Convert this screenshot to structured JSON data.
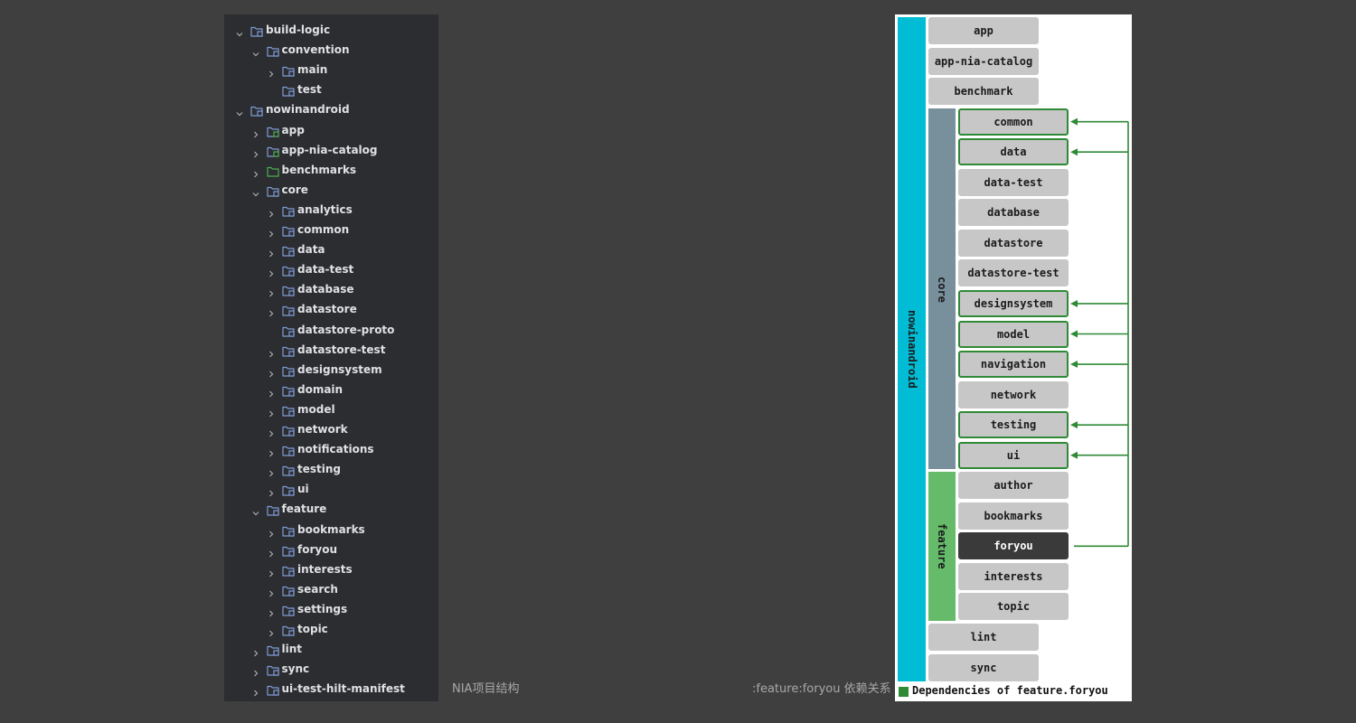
{
  "tree": [
    {
      "label": "build-logic",
      "depth": 0,
      "expanded": true,
      "icon": "module-folder-icon"
    },
    {
      "label": "convention",
      "depth": 1,
      "expanded": true,
      "icon": "module-folder-icon"
    },
    {
      "label": "main",
      "depth": 2,
      "expanded": false,
      "icon": "module-folder-icon"
    },
    {
      "label": "test",
      "depth": 2,
      "leaf": true,
      "icon": "module-folder-icon"
    },
    {
      "label": "nowinandroid",
      "depth": 0,
      "expanded": true,
      "icon": "module-folder-icon"
    },
    {
      "label": "app",
      "depth": 1,
      "expanded": false,
      "icon": "android-module-folder-icon"
    },
    {
      "label": "app-nia-catalog",
      "depth": 1,
      "expanded": false,
      "icon": "android-module-folder-icon"
    },
    {
      "label": "benchmarks",
      "depth": 1,
      "expanded": false,
      "icon": "test-folder-icon"
    },
    {
      "label": "core",
      "depth": 1,
      "expanded": true,
      "icon": "module-folder-icon"
    },
    {
      "label": "analytics",
      "depth": 2,
      "expanded": false,
      "icon": "module-folder-icon"
    },
    {
      "label": "common",
      "depth": 2,
      "expanded": false,
      "icon": "module-folder-icon"
    },
    {
      "label": "data",
      "depth": 2,
      "expanded": false,
      "icon": "module-folder-icon"
    },
    {
      "label": "data-test",
      "depth": 2,
      "expanded": false,
      "icon": "module-folder-icon"
    },
    {
      "label": "database",
      "depth": 2,
      "expanded": false,
      "icon": "module-folder-icon"
    },
    {
      "label": "datastore",
      "depth": 2,
      "expanded": false,
      "icon": "module-folder-icon"
    },
    {
      "label": "datastore-proto",
      "depth": 2,
      "leaf": true,
      "icon": "module-folder-icon"
    },
    {
      "label": "datastore-test",
      "depth": 2,
      "expanded": false,
      "icon": "module-folder-icon"
    },
    {
      "label": "designsystem",
      "depth": 2,
      "expanded": false,
      "icon": "module-folder-icon"
    },
    {
      "label": "domain",
      "depth": 2,
      "expanded": false,
      "icon": "module-folder-icon"
    },
    {
      "label": "model",
      "depth": 2,
      "expanded": false,
      "icon": "module-folder-icon"
    },
    {
      "label": "network",
      "depth": 2,
      "expanded": false,
      "icon": "module-folder-icon"
    },
    {
      "label": "notifications",
      "depth": 2,
      "expanded": false,
      "icon": "module-folder-icon"
    },
    {
      "label": "testing",
      "depth": 2,
      "expanded": false,
      "icon": "module-folder-icon"
    },
    {
      "label": "ui",
      "depth": 2,
      "expanded": false,
      "icon": "module-folder-icon"
    },
    {
      "label": "feature",
      "depth": 1,
      "expanded": true,
      "icon": "module-folder-icon"
    },
    {
      "label": "bookmarks",
      "depth": 2,
      "expanded": false,
      "icon": "module-folder-icon"
    },
    {
      "label": "foryou",
      "depth": 2,
      "expanded": false,
      "icon": "module-folder-icon"
    },
    {
      "label": "interests",
      "depth": 2,
      "expanded": false,
      "icon": "module-folder-icon"
    },
    {
      "label": "search",
      "depth": 2,
      "expanded": false,
      "icon": "module-folder-icon"
    },
    {
      "label": "settings",
      "depth": 2,
      "expanded": false,
      "icon": "module-folder-icon"
    },
    {
      "label": "topic",
      "depth": 2,
      "expanded": false,
      "icon": "module-folder-icon"
    },
    {
      "label": "lint",
      "depth": 1,
      "expanded": false,
      "icon": "module-folder-icon"
    },
    {
      "label": "sync",
      "depth": 1,
      "expanded": false,
      "icon": "module-folder-icon"
    },
    {
      "label": "ui-test-hilt-manifest",
      "depth": 1,
      "expanded": false,
      "icon": "module-folder-icon"
    }
  ],
  "captions": {
    "tree": "NIA项目结构",
    "diagram": ":feature:foryou 依赖关系"
  },
  "diagram": {
    "root_label": "nowinandroid",
    "core_label": "core",
    "feature_label": "feature",
    "top_nodes": [
      "app",
      "app-nia-catalog",
      "benchmark"
    ],
    "core_nodes": [
      {
        "label": "common",
        "dependency": true
      },
      {
        "label": "data",
        "dependency": true
      },
      {
        "label": "data-test",
        "dependency": false
      },
      {
        "label": "database",
        "dependency": false
      },
      {
        "label": "datastore",
        "dependency": false
      },
      {
        "label": "datastore-test",
        "dependency": false
      },
      {
        "label": "designsystem",
        "dependency": true
      },
      {
        "label": "model",
        "dependency": true
      },
      {
        "label": "navigation",
        "dependency": true
      },
      {
        "label": "network",
        "dependency": false
      },
      {
        "label": "testing",
        "dependency": true
      },
      {
        "label": "ui",
        "dependency": true
      }
    ],
    "feature_nodes": [
      {
        "label": "author",
        "selected": false
      },
      {
        "label": "bookmarks",
        "selected": false
      },
      {
        "label": "foryou",
        "selected": true
      },
      {
        "label": "interests",
        "selected": false
      },
      {
        "label": "topic",
        "selected": false
      }
    ],
    "bottom_nodes": [
      "lint",
      "sync"
    ],
    "legend": "Dependencies of feature.foryou",
    "colors": {
      "root_band": "#00bcd4",
      "core_band": "#78909c",
      "feature_band": "#66bb6a",
      "node": "#c7c7c7",
      "selected_node": "#3a3a3a",
      "dependency": "#2f8a36",
      "panel": "#2b2d30",
      "folder_icon": "#7f9bd6",
      "android_badge": "#4caf50"
    }
  }
}
